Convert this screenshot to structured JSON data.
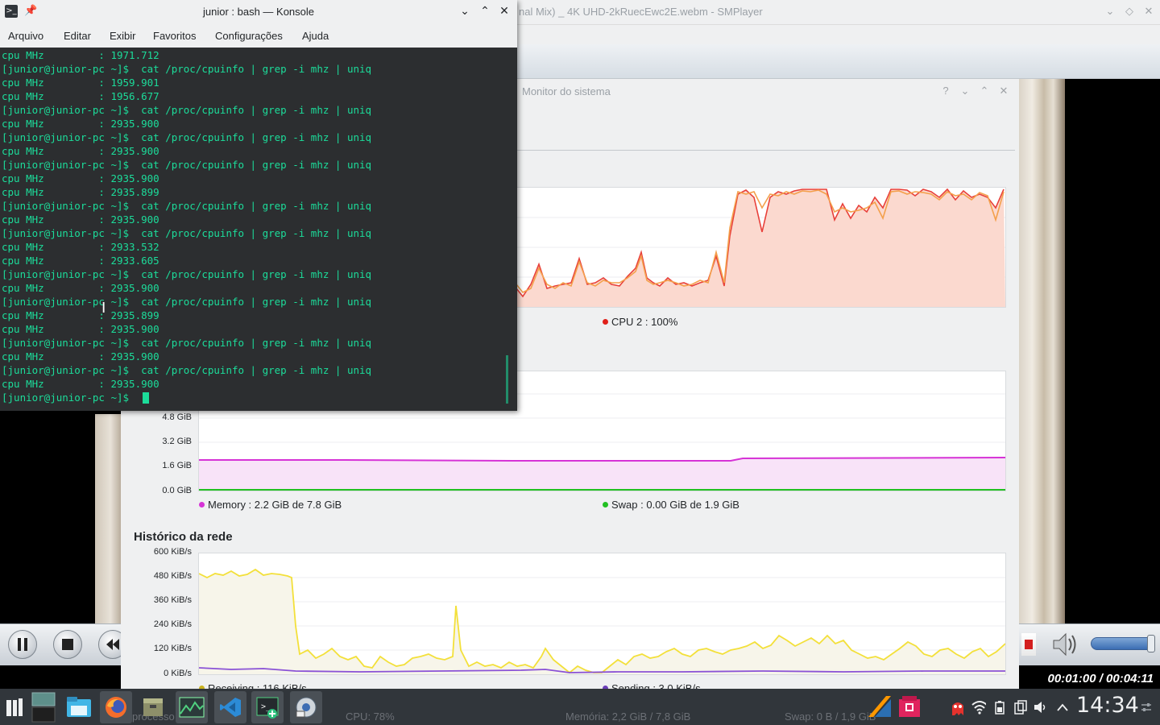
{
  "smplayer": {
    "title": "nal Mix) _ 4K UHD-2kRuecEwc2E.webm - SMPlayer",
    "time": "00:01:00 / 00:04:11"
  },
  "sysmon": {
    "title": "Monitor do sistema",
    "cpu": {
      "legend_cpu2": "CPU 2 : 100%",
      "colors": [
        "#e8403a",
        "#f4a04c"
      ]
    },
    "memory": {
      "yticks": [
        "4.8 GiB",
        "3.2 GiB",
        "1.6 GiB",
        "0.0 GiB"
      ],
      "legend_memory": "Memory : 2.2 GiB de 7.8 GiB",
      "legend_swap": "Swap : 0.00 GiB de 1.9 GiB",
      "colors": {
        "memory": "#d633d6",
        "swap": "#22c022"
      }
    },
    "network": {
      "title": "Histórico da rede",
      "yticks": [
        "600 KiB/s",
        "480 KiB/s",
        "360 KiB/s",
        "240 KiB/s",
        "120 KiB/s",
        "0 KiB/s"
      ],
      "legend_receiving": "Receiving : 116 KiB/s",
      "legend_sending": "Sending : 3.0 KiB/s",
      "colors": {
        "receiving": "#f3e03a",
        "sending": "#8a52d6"
      }
    },
    "status": {
      "processes": "processo",
      "cpu": "CPU: 78%",
      "memory": "Memória: 2,2 GiB / 7,8 GiB",
      "swap": "Swap: 0 B / 1,9 GiB"
    }
  },
  "konsole": {
    "title": "junior : bash — Konsole",
    "menu": [
      "Arquivo",
      "Editar",
      "Exibir",
      "Favoritos",
      "Configurações",
      "Ajuda"
    ],
    "lines": [
      "cpu MHz         : 1971.712",
      "[junior@junior-pc ~]$  cat /proc/cpuinfo | grep -i mhz | uniq",
      "cpu MHz         : 1959.901",
      "cpu MHz         : 1956.677",
      "[junior@junior-pc ~]$  cat /proc/cpuinfo | grep -i mhz | uniq",
      "cpu MHz         : 2935.900",
      "[junior@junior-pc ~]$  cat /proc/cpuinfo | grep -i mhz | uniq",
      "cpu MHz         : 2935.900",
      "[junior@junior-pc ~]$  cat /proc/cpuinfo | grep -i mhz | uniq",
      "cpu MHz         : 2935.900",
      "cpu MHz         : 2935.899",
      "[junior@junior-pc ~]$  cat /proc/cpuinfo | grep -i mhz | uniq",
      "cpu MHz         : 2935.900",
      "[junior@junior-pc ~]$  cat /proc/cpuinfo | grep -i mhz | uniq",
      "cpu MHz         : 2933.532",
      "cpu MHz         : 2933.605",
      "[junior@junior-pc ~]$  cat /proc/cpuinfo | grep -i mhz | uniq",
      "cpu MHz         : 2935.900",
      "[junior@junior-pc ~]$  cat /proc/cpuinfo | grep -i mhz | uniq",
      "cpu MHz         : 2935.899",
      "cpu MHz         : 2935.900",
      "[junior@junior-pc ~]$  cat /proc/cpuinfo | grep -i mhz | uniq",
      "cpu MHz         : 2935.900",
      "[junior@junior-pc ~]$  cat /proc/cpuinfo | grep -i mhz | uniq",
      "cpu MHz         : 2935.900",
      "[junior@junior-pc ~]$ "
    ]
  },
  "panel": {
    "clock": "14:34",
    "tasks": [
      "application-launcher-icon",
      "pager-icon",
      "file-manager-icon",
      "firefox-icon",
      "archive-manager-icon",
      "system-monitor-icon",
      "vscode-icon",
      "konsole-icon",
      "smplayer-icon"
    ],
    "tray": [
      "sublime-icon",
      "software-store-icon",
      "ghost-icon",
      "wifi-icon",
      "battery-icon",
      "devices-icon",
      "volume-icon",
      "expand-tray-icon",
      "panel-settings-icon"
    ]
  }
}
